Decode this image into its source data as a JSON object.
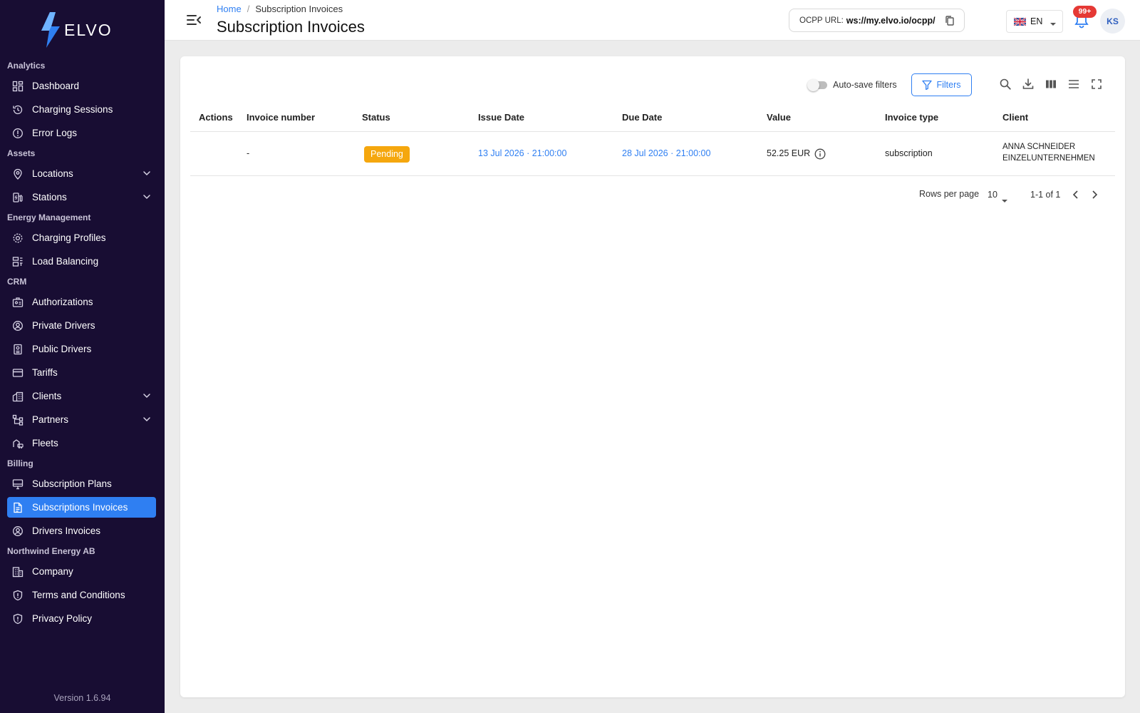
{
  "brand": {
    "name": "ELVO"
  },
  "sidebar": {
    "sections": [
      {
        "title": "Analytics",
        "items": [
          {
            "label": "Dashboard",
            "icon": "dashboard-icon"
          },
          {
            "label": "Charging Sessions",
            "icon": "history-icon"
          },
          {
            "label": "Error Logs",
            "icon": "alert-circle-icon"
          }
        ]
      },
      {
        "title": "Assets",
        "items": [
          {
            "label": "Locations",
            "icon": "location-pin-icon",
            "expandable": true
          },
          {
            "label": "Stations",
            "icon": "station-icon",
            "expandable": true
          }
        ]
      },
      {
        "title": "Energy Management",
        "items": [
          {
            "label": "Charging Profiles",
            "icon": "profile-gear-icon"
          },
          {
            "label": "Load Balancing",
            "icon": "load-balancing-icon"
          }
        ]
      },
      {
        "title": "CRM",
        "items": [
          {
            "label": "Authorizations",
            "icon": "id-badge-icon"
          },
          {
            "label": "Private Drivers",
            "icon": "user-circle-icon"
          },
          {
            "label": "Public Drivers",
            "icon": "driver-badge-icon"
          },
          {
            "label": "Tariffs",
            "icon": "card-icon"
          },
          {
            "label": "Clients",
            "icon": "building-icon",
            "expandable": true
          },
          {
            "label": "Partners",
            "icon": "hierarchy-icon",
            "expandable": true
          },
          {
            "label": "Fleets",
            "icon": "fleet-icon"
          }
        ]
      },
      {
        "title": "Billing",
        "items": [
          {
            "label": "Subscription Plans",
            "icon": "monitor-icon"
          },
          {
            "label": "Subscriptions Invoices",
            "icon": "document-icon",
            "active": true
          },
          {
            "label": "Drivers Invoices",
            "icon": "user-circle-icon"
          }
        ]
      },
      {
        "title": "Northwind Energy AB",
        "items": [
          {
            "label": "Company",
            "icon": "company-icon"
          },
          {
            "label": "Terms and Conditions",
            "icon": "shield-icon"
          },
          {
            "label": "Privacy Policy",
            "icon": "shield-icon"
          }
        ]
      }
    ],
    "version": "Version 1.6.94"
  },
  "header": {
    "breadcrumb_home": "Home",
    "breadcrumb_separator": "/",
    "breadcrumb_current": "Subscription Invoices",
    "title": "Subscription Invoices",
    "ocpp_label": "OCPP URL:",
    "ocpp_url": "ws://my.elvo.io/ocpp/",
    "language": "EN",
    "notification_count": "99+",
    "avatar_initials": "KS"
  },
  "toolbar": {
    "autosave_label": "Auto-save filters",
    "autosave_on": false,
    "filters_label": "Filters"
  },
  "table": {
    "columns": [
      "Actions",
      "Invoice number",
      "Status",
      "Issue Date",
      "Due Date",
      "Value",
      "Invoice type",
      "Client"
    ],
    "rows": [
      {
        "actions": "",
        "invoice_number": "-",
        "status": "Pending",
        "issue_date": "13 Jul 2026 · 21:00:00",
        "due_date": "28 Jul 2026 · 21:00:00",
        "value": "52.25 EUR",
        "invoice_type": "subscription",
        "client_line1": "ANNA SCHNEIDER",
        "client_line2": "EINZELUNTERNEHMEN"
      }
    ]
  },
  "pagination": {
    "rows_per_page_label": "Rows per page",
    "rows_per_page": "10",
    "range": "1-1 of 1"
  },
  "colors": {
    "sidebar_bg": "#180d33",
    "accent": "#2f7ff2",
    "status_pending": "#f5a70e",
    "badge": "#e53935"
  }
}
